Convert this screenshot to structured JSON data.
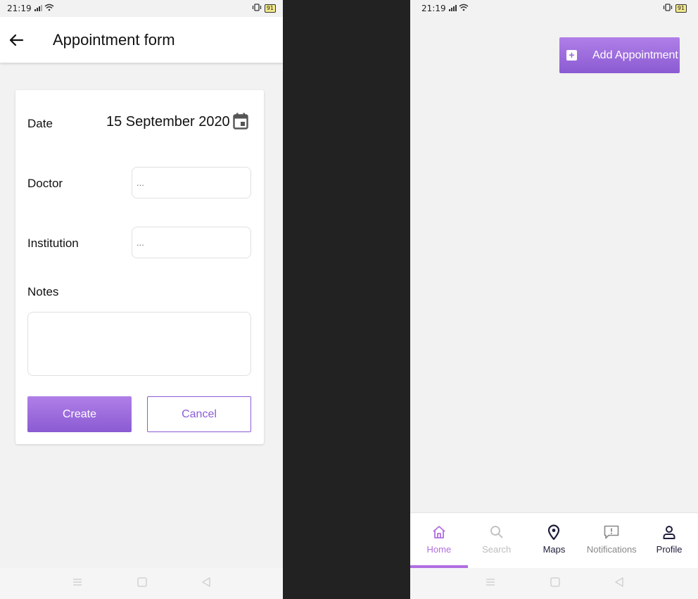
{
  "left": {
    "status": {
      "time": "21:19",
      "battery": "91"
    },
    "appbar": {
      "title": "Appointment form"
    },
    "form": {
      "date_label": "Date",
      "date_value": "15 September 2020",
      "doctor_label": "Doctor",
      "doctor_placeholder": "...",
      "institution_label": "Institution",
      "institution_placeholder": "...",
      "notes_label": "Notes",
      "create_label": "Create",
      "cancel_label": "Cancel"
    }
  },
  "right": {
    "status": {
      "time": "21:19",
      "battery": "91"
    },
    "add_button_label": "Add Appointment",
    "nav": [
      {
        "label": "Home",
        "icon": "home-icon",
        "active": true
      },
      {
        "label": "Search",
        "icon": "search-icon",
        "active": false
      },
      {
        "label": "Maps",
        "icon": "map-pin-icon",
        "active": false
      },
      {
        "label": "Notifications",
        "icon": "notification-icon",
        "active": false
      },
      {
        "label": "Profile",
        "icon": "profile-icon",
        "active": false
      }
    ]
  },
  "colors": {
    "accent": "#9b6ddc",
    "accent_light": "#b07fe8"
  }
}
